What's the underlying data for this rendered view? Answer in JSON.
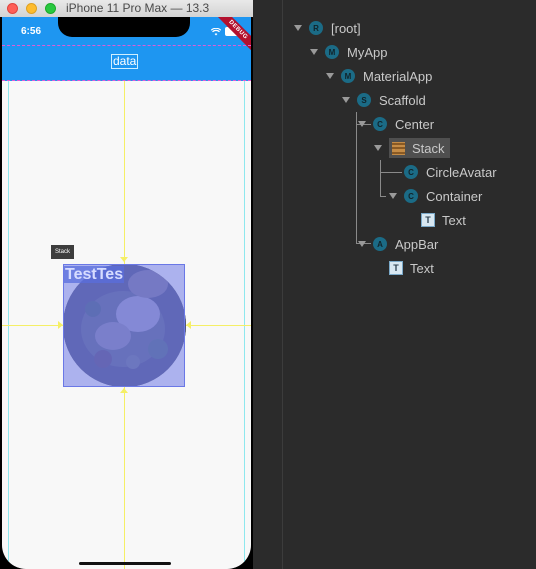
{
  "simulator": {
    "window_title": "iPhone 11 Pro Max — 13.3",
    "status_time": "6:56",
    "wifi_icon": "wifi-icon",
    "debug_banner": "DEBUG",
    "appbar_title": "data",
    "stack_tooltip": "Stack",
    "overlay_text": "TestTes",
    "colors": {
      "appbar": "#1e96f1",
      "selection_fill": "#6e78e6",
      "guide_lines": "#f5ef66",
      "debug_banner": "#b3112e"
    }
  },
  "inspector": {
    "tree": [
      {
        "label": "[root]",
        "badge": "R"
      },
      {
        "label": "MyApp",
        "badge": "M"
      },
      {
        "label": "MaterialApp",
        "badge": "M"
      },
      {
        "label": "Scaffold",
        "badge": "S"
      },
      {
        "label": "Center",
        "badge": "C"
      },
      {
        "label": "Stack",
        "badge": "stack",
        "selected": true
      },
      {
        "label": "CircleAvatar",
        "badge": "C"
      },
      {
        "label": "Container",
        "badge": "C"
      },
      {
        "label": "Text",
        "badge": "T"
      },
      {
        "label": "AppBar",
        "badge": "A"
      },
      {
        "label": "Text",
        "badge": "T"
      }
    ]
  }
}
